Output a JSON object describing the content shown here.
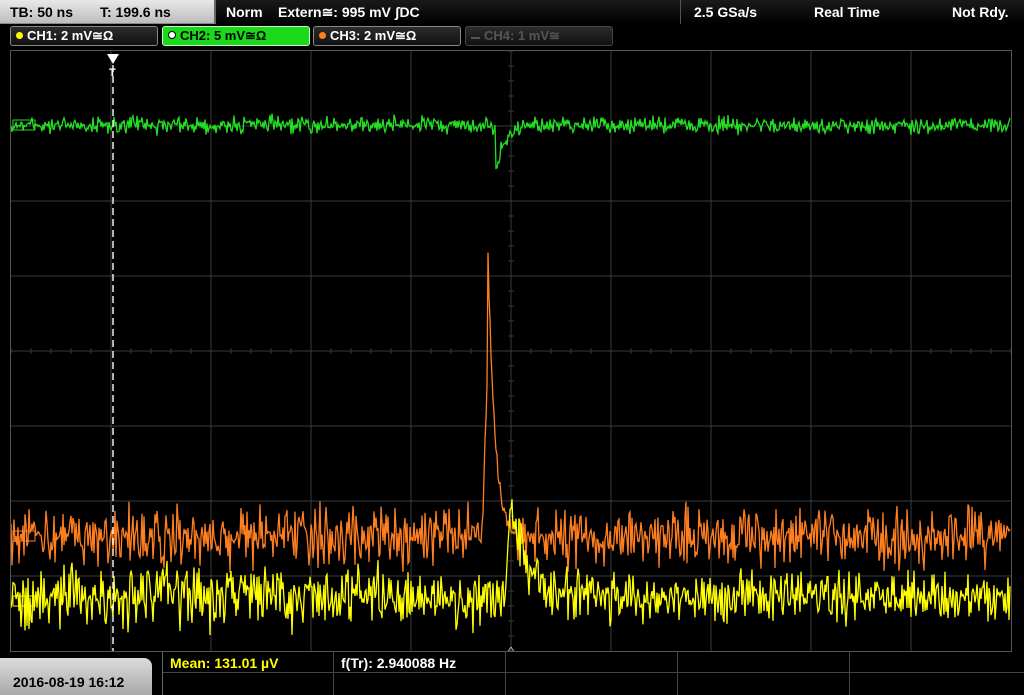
{
  "topbar": {
    "timebase": "TB: 50 ns",
    "trigger_time": "T: 199.6 ns",
    "mode": "Norm",
    "trigger_source": "Extern≅: 995 mV ʃDC",
    "sample_rate": "2.5 GSa/s",
    "acq_mode": "Real Time",
    "status": "Not Rdy."
  },
  "channels": [
    {
      "label": "CH1: 2 mV≅Ω",
      "color": "#ffff00"
    },
    {
      "label": "CH2: 5 mV≅Ω",
      "color": "#1ad81a"
    },
    {
      "label": "CH3: 2 mV≅Ω",
      "color": "#ff7f1f"
    },
    {
      "label": "CH4: 1 mV≅",
      "color": "#555555"
    }
  ],
  "footer": {
    "datetime": "2016-08-19 16:12",
    "mean": "Mean: 131.01 µV",
    "freq": "f(Tr): 2.940088 Hz"
  },
  "colors": {
    "ch1": "#ffff00",
    "ch2": "#22e022",
    "ch3": "#ff7f1f",
    "grid": "#3a3a3a"
  }
}
